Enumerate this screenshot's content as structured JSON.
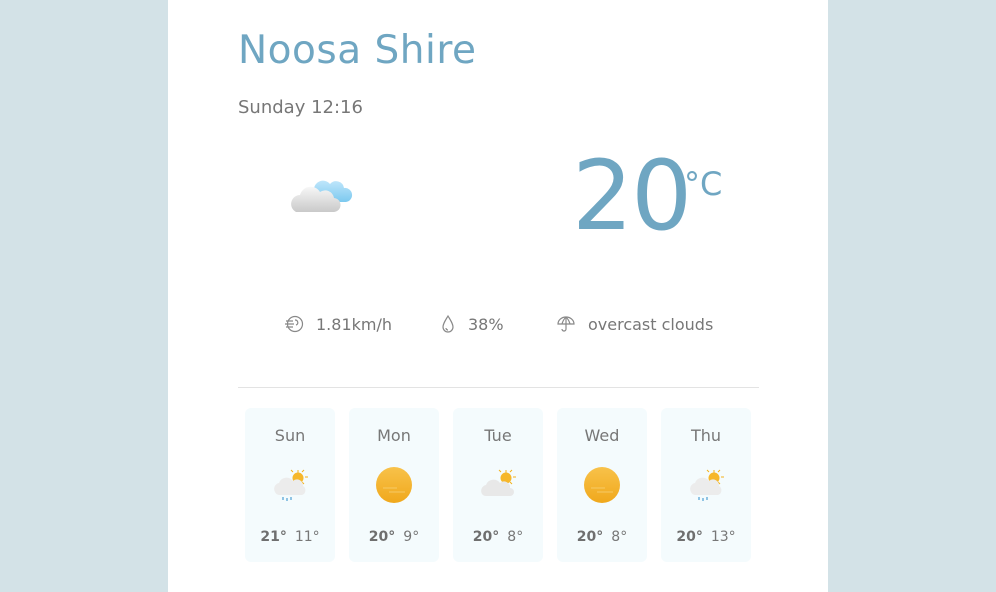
{
  "location": {
    "city": "Noosa Shire",
    "datetime": "Sunday 12:16"
  },
  "current": {
    "icon": "overcast-clouds-icon",
    "temperature": "20",
    "unit": "°C",
    "wind": "1.81km/h",
    "humidity": "38%",
    "description": "overcast clouds"
  },
  "forecast": [
    {
      "day": "Sun",
      "icon": "sun-cloud-rain-icon",
      "high": "21°",
      "low": "11°"
    },
    {
      "day": "Mon",
      "icon": "sun-icon",
      "high": "20°",
      "low": "9°"
    },
    {
      "day": "Tue",
      "icon": "sun-cloud-icon",
      "high": "20°",
      "low": "8°"
    },
    {
      "day": "Wed",
      "icon": "sun-icon",
      "high": "20°",
      "low": "8°"
    },
    {
      "day": "Thu",
      "icon": "sun-cloud-rain-icon",
      "high": "20°",
      "low": "13°"
    }
  ],
  "colors": {
    "background": "#d3e2e7",
    "card": "#ffffff",
    "accent": "#6fa6c2",
    "forecast_card": "#f4fbfd"
  }
}
